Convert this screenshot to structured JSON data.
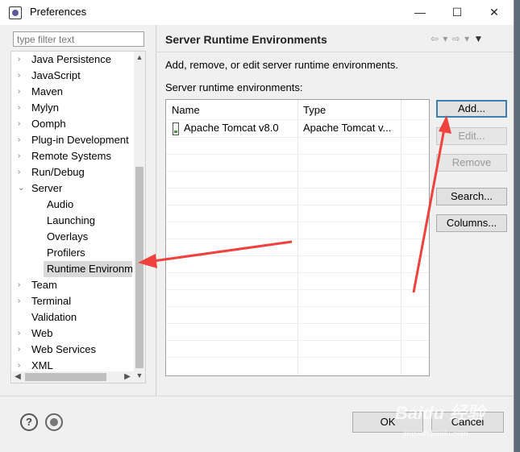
{
  "window": {
    "title": "Preferences",
    "controls": [
      "—",
      "☐",
      "✕"
    ]
  },
  "filter": {
    "placeholder": "type filter text"
  },
  "tree": {
    "items": [
      {
        "label": "Java Persistence",
        "arrow": "›"
      },
      {
        "label": "JavaScript",
        "arrow": "›"
      },
      {
        "label": "Maven",
        "arrow": "›"
      },
      {
        "label": "Mylyn",
        "arrow": "›"
      },
      {
        "label": "Oomph",
        "arrow": "›"
      },
      {
        "label": "Plug-in Development",
        "arrow": "›"
      },
      {
        "label": "Remote Systems",
        "arrow": "›"
      },
      {
        "label": "Run/Debug",
        "arrow": "›"
      },
      {
        "label": "Server",
        "arrow": "⌄"
      },
      {
        "label": "Audio"
      },
      {
        "label": "Launching"
      },
      {
        "label": "Overlays"
      },
      {
        "label": "Profilers"
      },
      {
        "label": "Runtime Environm"
      },
      {
        "label": "Team",
        "arrow": "›"
      },
      {
        "label": "Terminal",
        "arrow": "›"
      },
      {
        "label": "Validation"
      },
      {
        "label": "Web",
        "arrow": "›"
      },
      {
        "label": "Web Services",
        "arrow": "›"
      },
      {
        "label": "XML",
        "arrow": "›"
      }
    ],
    "scroll_up": "▲",
    "scroll_down": "▼",
    "scroll_left": "◀",
    "scroll_right": "▶"
  },
  "page": {
    "title": "Server Runtime Environments",
    "nav": {
      "back": "⇦ ▾",
      "forward": "⇨ ▾",
      "menu": "▼"
    },
    "description": "Add, remove, or edit server runtime environments.",
    "list_label": "Server runtime environments:",
    "table": {
      "columns": [
        "Name",
        "Type"
      ],
      "rows": [
        {
          "name": "Apache Tomcat v8.0",
          "type": "Apache Tomcat v..."
        }
      ]
    },
    "buttons": {
      "add": "Add...",
      "edit": "Edit...",
      "remove": "Remove",
      "search": "Search...",
      "columns": "Columns..."
    }
  },
  "footer": {
    "help": "?",
    "ok": "OK",
    "cancel": "Cancel"
  },
  "watermark": {
    "text": "Baidu 经验",
    "sub": "jingyan.baidu.com"
  },
  "colors": {
    "annotation_arrow": "#f0413c",
    "focus_border": "#3c7fb1"
  }
}
